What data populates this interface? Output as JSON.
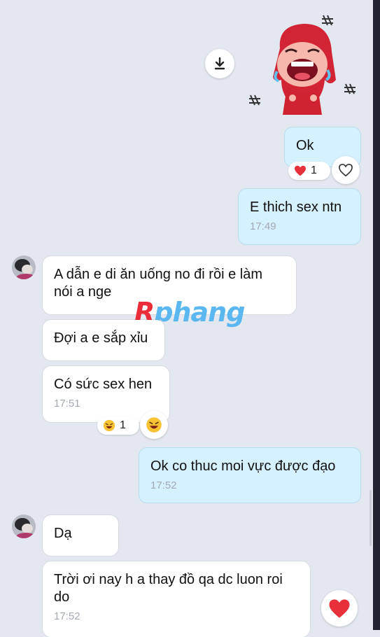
{
  "messages": {
    "m1": {
      "text": "Ok"
    },
    "m2": {
      "text": "E thich sex ntn",
      "time": "17:49"
    },
    "m3": {
      "text": "A dẫn e di ăn uống no đi rồi e làm nói a nge"
    },
    "m4": {
      "text": "Đợi a e sắp xỉu"
    },
    "m5": {
      "text": "Có sức sex hen",
      "time": "17:51"
    },
    "m6": {
      "text": "Ok co thuc moi vực được đạo",
      "time": "17:52"
    },
    "m7": {
      "text": "Dạ"
    },
    "m8": {
      "text": "Trời ơi nay h a thay đồ qa dc luon roi do",
      "time": "17:52"
    }
  },
  "reactions": {
    "r1": {
      "emoji": "heart",
      "count": "1"
    },
    "r2": {
      "emoji": "laughing-face",
      "count": "1"
    }
  },
  "watermark": {
    "r": "R",
    "rest": "phang"
  },
  "colors": {
    "background": "#e3e7ef",
    "outgoing_bubble": "#d5f0fe",
    "incoming_bubble": "#ffffff",
    "heart": "#e8303a",
    "timestamp": "#a3a9b3"
  },
  "icons": [
    "download-icon",
    "heart-outline-icon",
    "heart-icon",
    "laughing-face-icon",
    "sticker"
  ]
}
